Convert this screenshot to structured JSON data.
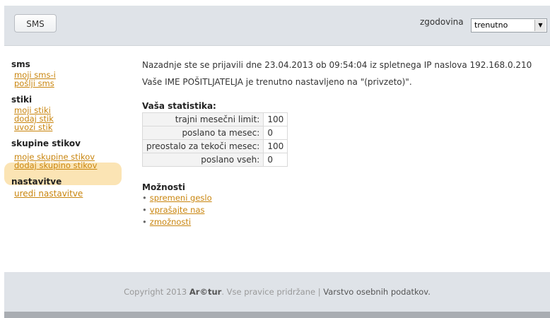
{
  "header": {
    "sms_button": "SMS",
    "history_label": "zgodovina",
    "history_select": "trenutno"
  },
  "sidebar": {
    "sections": [
      {
        "title": "sms",
        "links": [
          "moji sms-i",
          "pošlji sms"
        ]
      },
      {
        "title": "stiki",
        "links": [
          "moji stiki",
          "dodaj stik",
          "uvozi stik"
        ]
      },
      {
        "title": "skupine stikov",
        "links": [
          "moje skupine stikov",
          "dodaj skupino stikov"
        ]
      },
      {
        "title": "nastavitve",
        "links": [
          "uredi nastavitve"
        ]
      }
    ]
  },
  "main": {
    "last_login": "Nazadnje ste se prijavili dne 23.04.2013 ob 09:54:04 iz spletnega IP naslova 192.168.0.210",
    "sender_name": "Vaše IME POŠITLJATELJA je trenutno nastavljeno na \"(privzeto)\".",
    "stats_title": "Vaša statistika:",
    "stats": [
      {
        "label": "trajni mesečni limit:",
        "value": "100"
      },
      {
        "label": "poslano ta mesec:",
        "value": "0"
      },
      {
        "label": "preostalo za tekoči mesec:",
        "value": "100"
      },
      {
        "label": "poslano vseh:",
        "value": "0"
      }
    ],
    "options_title": "Možnosti",
    "options": [
      "spremeni geslo",
      "vprašajte nas",
      "zmožnosti"
    ]
  },
  "footer": {
    "copyright_pre": "Copyright 2013",
    "brand": "Ar©tur",
    "copyright_post": ". Vse pravice pridržane",
    "separator": "|",
    "privacy": "Varstvo osebnih podatkov."
  },
  "colors": {
    "accent_link": "#c9850e",
    "highlight": "#fbe4b4",
    "header_bg": "#dfe3e8"
  }
}
